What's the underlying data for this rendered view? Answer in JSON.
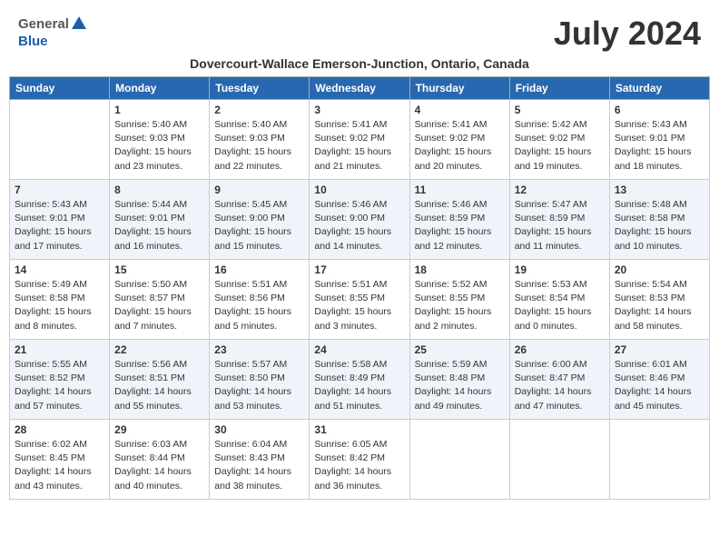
{
  "header": {
    "logo_general": "General",
    "logo_blue": "Blue",
    "month_title": "July 2024",
    "subtitle": "Dovercourt-Wallace Emerson-Junction, Ontario, Canada"
  },
  "days_of_week": [
    "Sunday",
    "Monday",
    "Tuesday",
    "Wednesday",
    "Thursday",
    "Friday",
    "Saturday"
  ],
  "weeks": [
    [
      {
        "day": "",
        "text": ""
      },
      {
        "day": "1",
        "text": "Sunrise: 5:40 AM\nSunset: 9:03 PM\nDaylight: 15 hours\nand 23 minutes."
      },
      {
        "day": "2",
        "text": "Sunrise: 5:40 AM\nSunset: 9:03 PM\nDaylight: 15 hours\nand 22 minutes."
      },
      {
        "day": "3",
        "text": "Sunrise: 5:41 AM\nSunset: 9:02 PM\nDaylight: 15 hours\nand 21 minutes."
      },
      {
        "day": "4",
        "text": "Sunrise: 5:41 AM\nSunset: 9:02 PM\nDaylight: 15 hours\nand 20 minutes."
      },
      {
        "day": "5",
        "text": "Sunrise: 5:42 AM\nSunset: 9:02 PM\nDaylight: 15 hours\nand 19 minutes."
      },
      {
        "day": "6",
        "text": "Sunrise: 5:43 AM\nSunset: 9:01 PM\nDaylight: 15 hours\nand 18 minutes."
      }
    ],
    [
      {
        "day": "7",
        "text": "Sunrise: 5:43 AM\nSunset: 9:01 PM\nDaylight: 15 hours\nand 17 minutes."
      },
      {
        "day": "8",
        "text": "Sunrise: 5:44 AM\nSunset: 9:01 PM\nDaylight: 15 hours\nand 16 minutes."
      },
      {
        "day": "9",
        "text": "Sunrise: 5:45 AM\nSunset: 9:00 PM\nDaylight: 15 hours\nand 15 minutes."
      },
      {
        "day": "10",
        "text": "Sunrise: 5:46 AM\nSunset: 9:00 PM\nDaylight: 15 hours\nand 14 minutes."
      },
      {
        "day": "11",
        "text": "Sunrise: 5:46 AM\nSunset: 8:59 PM\nDaylight: 15 hours\nand 12 minutes."
      },
      {
        "day": "12",
        "text": "Sunrise: 5:47 AM\nSunset: 8:59 PM\nDaylight: 15 hours\nand 11 minutes."
      },
      {
        "day": "13",
        "text": "Sunrise: 5:48 AM\nSunset: 8:58 PM\nDaylight: 15 hours\nand 10 minutes."
      }
    ],
    [
      {
        "day": "14",
        "text": "Sunrise: 5:49 AM\nSunset: 8:58 PM\nDaylight: 15 hours\nand 8 minutes."
      },
      {
        "day": "15",
        "text": "Sunrise: 5:50 AM\nSunset: 8:57 PM\nDaylight: 15 hours\nand 7 minutes."
      },
      {
        "day": "16",
        "text": "Sunrise: 5:51 AM\nSunset: 8:56 PM\nDaylight: 15 hours\nand 5 minutes."
      },
      {
        "day": "17",
        "text": "Sunrise: 5:51 AM\nSunset: 8:55 PM\nDaylight: 15 hours\nand 3 minutes."
      },
      {
        "day": "18",
        "text": "Sunrise: 5:52 AM\nSunset: 8:55 PM\nDaylight: 15 hours\nand 2 minutes."
      },
      {
        "day": "19",
        "text": "Sunrise: 5:53 AM\nSunset: 8:54 PM\nDaylight: 15 hours\nand 0 minutes."
      },
      {
        "day": "20",
        "text": "Sunrise: 5:54 AM\nSunset: 8:53 PM\nDaylight: 14 hours\nand 58 minutes."
      }
    ],
    [
      {
        "day": "21",
        "text": "Sunrise: 5:55 AM\nSunset: 8:52 PM\nDaylight: 14 hours\nand 57 minutes."
      },
      {
        "day": "22",
        "text": "Sunrise: 5:56 AM\nSunset: 8:51 PM\nDaylight: 14 hours\nand 55 minutes."
      },
      {
        "day": "23",
        "text": "Sunrise: 5:57 AM\nSunset: 8:50 PM\nDaylight: 14 hours\nand 53 minutes."
      },
      {
        "day": "24",
        "text": "Sunrise: 5:58 AM\nSunset: 8:49 PM\nDaylight: 14 hours\nand 51 minutes."
      },
      {
        "day": "25",
        "text": "Sunrise: 5:59 AM\nSunset: 8:48 PM\nDaylight: 14 hours\nand 49 minutes."
      },
      {
        "day": "26",
        "text": "Sunrise: 6:00 AM\nSunset: 8:47 PM\nDaylight: 14 hours\nand 47 minutes."
      },
      {
        "day": "27",
        "text": "Sunrise: 6:01 AM\nSunset: 8:46 PM\nDaylight: 14 hours\nand 45 minutes."
      }
    ],
    [
      {
        "day": "28",
        "text": "Sunrise: 6:02 AM\nSunset: 8:45 PM\nDaylight: 14 hours\nand 43 minutes."
      },
      {
        "day": "29",
        "text": "Sunrise: 6:03 AM\nSunset: 8:44 PM\nDaylight: 14 hours\nand 40 minutes."
      },
      {
        "day": "30",
        "text": "Sunrise: 6:04 AM\nSunset: 8:43 PM\nDaylight: 14 hours\nand 38 minutes."
      },
      {
        "day": "31",
        "text": "Sunrise: 6:05 AM\nSunset: 8:42 PM\nDaylight: 14 hours\nand 36 minutes."
      },
      {
        "day": "",
        "text": ""
      },
      {
        "day": "",
        "text": ""
      },
      {
        "day": "",
        "text": ""
      }
    ]
  ]
}
